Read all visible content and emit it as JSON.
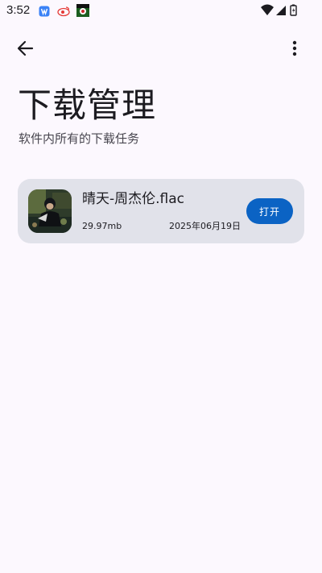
{
  "status_bar": {
    "time": "3:52",
    "notification_icons": [
      "app-notification-icon",
      "weibo-notification-icon",
      "game-notification-icon"
    ],
    "system_icons": [
      "wifi-icon",
      "signal-icon",
      "battery-icon"
    ]
  },
  "toolbar": {
    "back_icon": "arrow-back-icon",
    "more_icon": "more-vert-icon"
  },
  "header": {
    "title": "下载管理",
    "subtitle": "软件内所有的下载任务"
  },
  "downloads": [
    {
      "name": "晴天-周杰伦.flac",
      "size": "29.97mb",
      "date": "2025年06月19日",
      "action_label": "打开"
    }
  ],
  "colors": {
    "background": "#fcf8fe",
    "card": "#e1e2ea",
    "accent": "#0b63c4"
  }
}
